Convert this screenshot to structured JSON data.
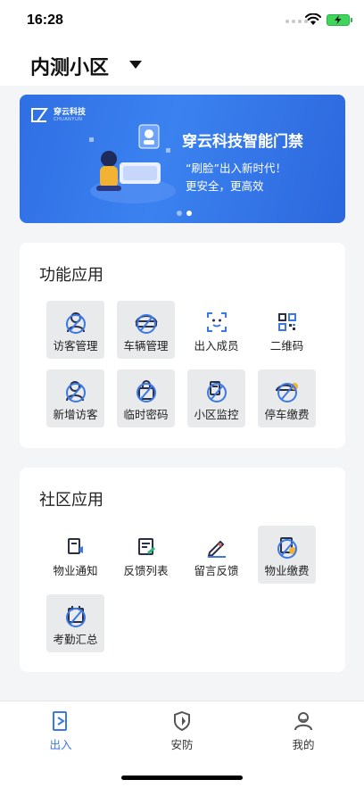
{
  "status_bar": {
    "time": "16:28",
    "wifi_icon": "wifi-icon",
    "battery_icon": "battery-charging-icon",
    "battery_color": "#3fd45a"
  },
  "header": {
    "community_name": "内测小区",
    "dropdown_icon": "caret-down-icon"
  },
  "banner": {
    "logo_cn": "穿云科技",
    "logo_en": "CHUANYUN",
    "title": "穿云科技智能门禁",
    "line1": "“刷脸”出入新时代！",
    "line2": "更安全，更高效",
    "page_count": 2,
    "active_page": 1
  },
  "function_apps": {
    "title": "功能应用",
    "items": [
      {
        "label": "访客管理",
        "icon": "visitor-icon",
        "highlighted": true
      },
      {
        "label": "车辆管理",
        "icon": "car-icon",
        "highlighted": true
      },
      {
        "label": "出入成员",
        "icon": "face-scan-icon",
        "highlighted": false
      },
      {
        "label": "二维码",
        "icon": "qr-code-icon",
        "highlighted": false
      },
      {
        "label": "新增访客",
        "icon": "add-visitor-icon",
        "highlighted": true
      },
      {
        "label": "临时密码",
        "icon": "temp-password-icon",
        "highlighted": true
      },
      {
        "label": "小区监控",
        "icon": "monitor-icon",
        "highlighted": true
      },
      {
        "label": "停车缴费",
        "icon": "parking-fee-icon",
        "highlighted": true
      }
    ]
  },
  "community_apps": {
    "title": "社区应用",
    "items": [
      {
        "label": "物业通知",
        "icon": "notice-icon",
        "highlighted": false
      },
      {
        "label": "反馈列表",
        "icon": "feedback-list-icon",
        "highlighted": false
      },
      {
        "label": "留言反馈",
        "icon": "pen-icon",
        "highlighted": false
      },
      {
        "label": "物业缴费",
        "icon": "property-fee-icon",
        "highlighted": true
      },
      {
        "label": "考勤汇总",
        "icon": "attendance-icon",
        "highlighted": true
      }
    ]
  },
  "tabbar": {
    "tabs": [
      {
        "label": "出入",
        "icon": "access-icon",
        "active": true
      },
      {
        "label": "安防",
        "icon": "shield-icon",
        "active": false
      },
      {
        "label": "我的",
        "icon": "profile-icon",
        "active": false
      }
    ]
  },
  "colors": {
    "accent": "#3b78e7",
    "banner": "#2f6fe4",
    "tile_highlight": "#e9eaec",
    "background": "#f4f5f7"
  }
}
